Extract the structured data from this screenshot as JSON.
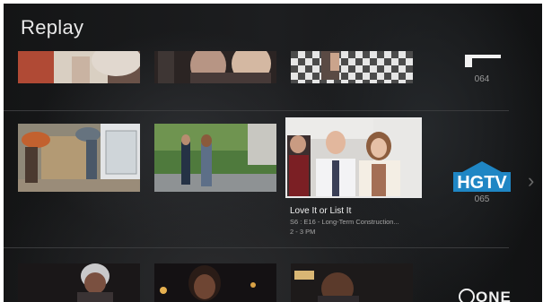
{
  "header": {
    "title": "Replay"
  },
  "channels": [
    {
      "number": "064"
    },
    {
      "number": "065",
      "logo_text": "HGTV"
    },
    {
      "logo_text": "ONE"
    }
  ],
  "focused_program": {
    "title": "Love It or List It",
    "episode": "S6 : E16 - Long-Term Construction...",
    "time": "2 - 3 PM"
  },
  "colors": {
    "background": "#1a1b1d",
    "text_primary": "#f2f2f2",
    "text_secondary": "#a5a5a5",
    "hgtv_blue": "#1f86c4",
    "focus_outline": "#e9e9e9"
  },
  "icons": {
    "next": "chevron-right-icon"
  },
  "next_glyph": "›"
}
